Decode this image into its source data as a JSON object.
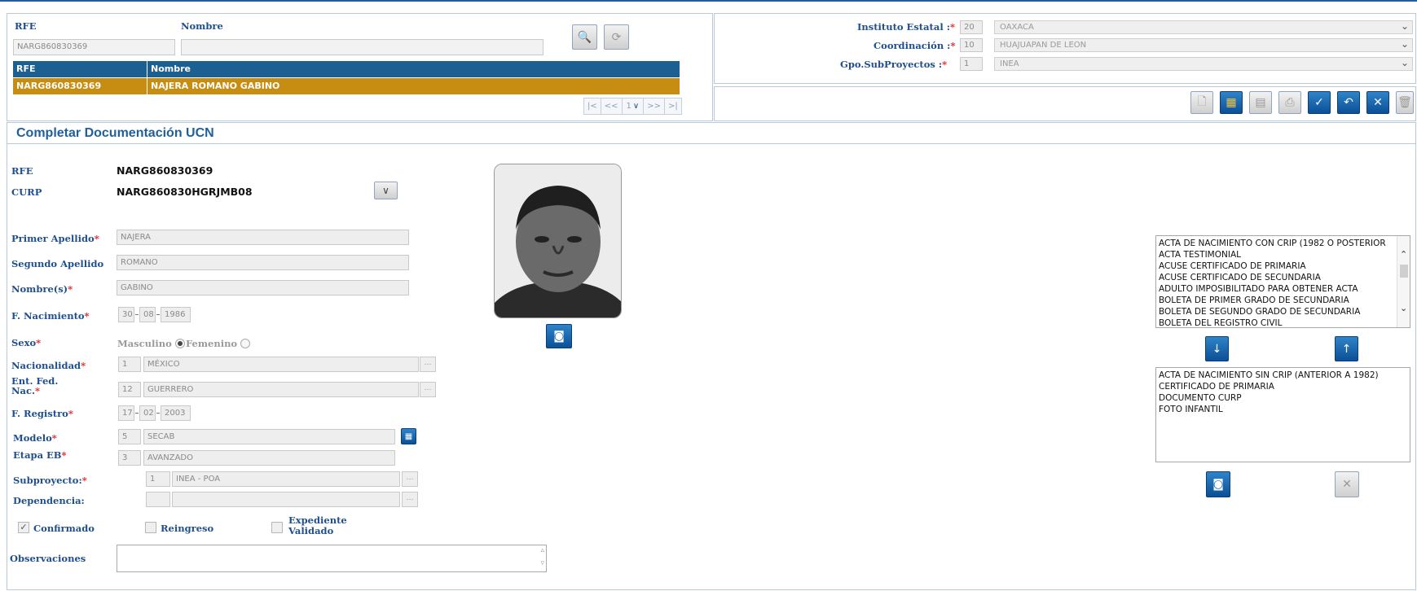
{
  "header": {
    "rfe_label": "RFE",
    "nombre_label": "Nombre",
    "rfe_value": "NARG860830369",
    "nombre_value": "",
    "table": {
      "columns": [
        "RFE",
        "Nombre"
      ],
      "rows": [
        [
          "NARG860830369",
          "NAJERA ROMANO GABINO"
        ]
      ]
    },
    "pager": {
      "first": "|<",
      "prev": "<<",
      "page": "1",
      "next": ">>",
      "last": ">|"
    }
  },
  "filters": {
    "instituto_label": "Instituto Estatal :",
    "instituto_code": "20",
    "instituto_value": "OAXACA",
    "coordinacion_label": "Coordinación :",
    "coordinacion_code": "10",
    "coordinacion_value": "HUAJUAPAN DE LEON",
    "gpo_label": "Gpo.SubProyectos :",
    "gpo_code": "1",
    "gpo_value": "INEA",
    "required_mark": "*"
  },
  "section_title": "Completar Documentación UCN",
  "form": {
    "rfe_label": "RFE",
    "rfe_value": "NARG860830369",
    "curp_label": "CURP",
    "curp_value": "NARG860830HGRJMB08",
    "primer_apellido_label": "Primer Apellido",
    "primer_apellido": "NAJERA",
    "segundo_apellido_label": "Segundo Apellido",
    "segundo_apellido": "ROMANO",
    "nombres_label": "Nombre(s)",
    "nombres": "GABINO",
    "f_nac_label": "F. Nacimiento",
    "f_nac_d": "30",
    "f_nac_m": "08",
    "f_nac_y": "1986",
    "sexo_label": "Sexo",
    "sexo_masculino": "Masculino",
    "sexo_femenino": "Femenino",
    "nacionalidad_label": "Nacionalidad",
    "nacionalidad_code": "1",
    "nacionalidad_value": "MÉXICO",
    "ent_fed_label_1": "Ent. Fed.",
    "ent_fed_label_2": "Nac.",
    "ent_fed_code": "12",
    "ent_fed_value": "GUERRERO",
    "f_registro_label": "F. Registro",
    "f_reg_d": "17",
    "f_reg_m": "02",
    "f_reg_y": "2003",
    "modelo_label": "Modelo",
    "modelo_code": "5",
    "modelo_value": "SECAB",
    "etapa_label": "Etapa EB",
    "etapa_code": "3",
    "etapa_value": "AVANZADO",
    "subproyecto_label": "Subproyecto:",
    "subproyecto_code": "1",
    "subproyecto_value": "INEA - POA",
    "dependencia_label": "Dependencia:",
    "dependencia_code": "",
    "dependencia_value": "",
    "confirmado_label": "Confirmado",
    "reingreso_label": "Reingreso",
    "expediente_label_1": "Expediente",
    "expediente_label_2": "Validado",
    "observaciones_label": "Observaciones",
    "observaciones_value": ""
  },
  "documents_available": [
    "ACTA DE NACIMIENTO CON CRIP (1982 O POSTERIOR",
    "ACTA TESTIMONIAL",
    "ACUSE CERTIFICADO DE PRIMARIA",
    "ACUSE CERTIFICADO DE SECUNDARIA",
    "ADULTO IMPOSIBILITADO PARA OBTENER ACTA",
    "BOLETA DE PRIMER GRADO DE SECUNDARIA",
    "BOLETA DE SEGUNDO GRADO DE SECUNDARIA",
    "BOLETA DEL REGISTRO CIVIL"
  ],
  "documents_selected": [
    "ACTA DE NACIMIENTO SIN CRIP (ANTERIOR A 1982)",
    "CERTIFICADO DE PRIMARIA",
    "DOCUMENTO CURP",
    "FOTO INFANTIL"
  ]
}
